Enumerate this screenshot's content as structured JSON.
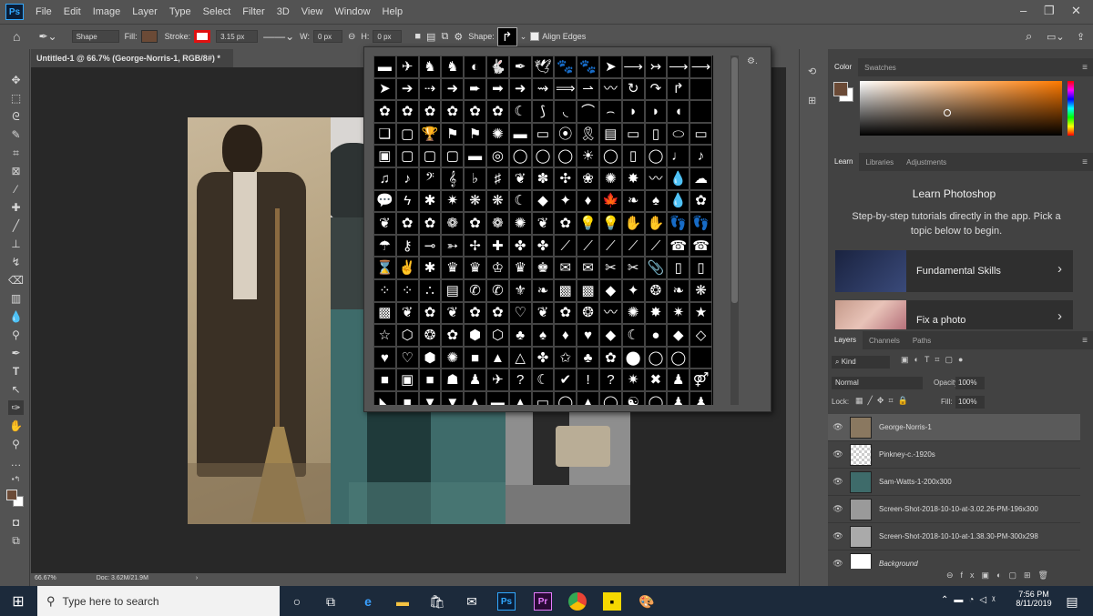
{
  "menubar": {
    "logo": "Ps",
    "items": [
      "File",
      "Edit",
      "Image",
      "Layer",
      "Type",
      "Select",
      "Filter",
      "3D",
      "View",
      "Window",
      "Help"
    ]
  },
  "options": {
    "mode": "Shape",
    "fill_label": "Fill:",
    "stroke_label": "Stroke:",
    "stroke_width": "3.15 px",
    "w_label": "W:",
    "w_value": "0 px",
    "h_label": "H:",
    "h_value": "0 px",
    "shape_label": "Shape:",
    "align_edges": "Align Edges"
  },
  "document": {
    "tab_title": "Untitled-1 @ 66.7% (George-Norris-1, RGB/8#) *",
    "zoom": "66.67%",
    "doc_info": "Doc: 3.62M/21.9M"
  },
  "shape_picker": {
    "shapes": [
      "▬",
      "✈",
      "♞",
      "♞",
      "◐",
      "🐇",
      "✒",
      "🕊",
      "🐾",
      "🐾",
      "➤",
      "⟶",
      "↣",
      "⟶",
      "⟶",
      "➤",
      "➔",
      "⇢",
      "➜",
      "➨",
      "➡",
      "➜",
      "⇝",
      "⟹",
      "⇀",
      "〰",
      "↻",
      "↷",
      "↱",
      "",
      "✿",
      "✿",
      "✿",
      "✿",
      "✿",
      "✿",
      "☾",
      "⟆",
      "◟",
      "⌒",
      "⌢",
      "◗",
      "◗",
      "◖",
      "",
      "❑",
      "▢",
      "🏆",
      "⚑",
      "⚑",
      "✺",
      "▬",
      "▭",
      "⦿",
      "🎗",
      "▤",
      "▭",
      "▯",
      "⬭",
      "▭",
      "▣",
      "▢",
      "▢",
      "▢",
      "▬",
      "◎",
      "◯",
      "◯",
      "◯",
      "☀",
      "◯",
      "▯",
      "◯",
      "♩",
      "♪",
      "♫",
      "♪",
      "𝄢",
      "𝄞",
      "♭",
      "♯",
      "❦",
      "✽",
      "✣",
      "❀",
      "✺",
      "✸",
      "〰",
      "💧",
      "☁",
      "💬",
      "ϟ",
      "✱",
      "✷",
      "❋",
      "❋",
      "☾",
      "◆",
      "✦",
      "♦",
      "🍁",
      "❧",
      "♠",
      "💧",
      "✿",
      "❦",
      "✿",
      "✿",
      "❁",
      "✿",
      "❁",
      "✺",
      "❦",
      "✿",
      "💡",
      "💡",
      "✋",
      "✋",
      "👣",
      "👣",
      "☂",
      "⚷",
      "⊸",
      "➳",
      "✢",
      "✚",
      "✤",
      "✤",
      "⟋",
      "⟋",
      "⟋",
      "⟋",
      "⟋",
      "☎",
      "☎",
      "⌛",
      "✌",
      "✱",
      "♛",
      "♛",
      "♔",
      "♛",
      "♚",
      "✉",
      "✉",
      "✂",
      "✂",
      "📎",
      "▯",
      "▯",
      "⁘",
      "⁘",
      "∴",
      "▤",
      "✆",
      "✆",
      "⚜",
      "❧",
      "▩",
      "▩",
      "◆",
      "✦",
      "❂",
      "❧",
      "❋",
      "▩",
      "❦",
      "✿",
      "❦",
      "✿",
      "✿",
      "♡",
      "❦",
      "✿",
      "❂",
      "〰",
      "✺",
      "✸",
      "✷",
      "★",
      "☆",
      "⬡",
      "❂",
      "✿",
      "⬢",
      "⬡",
      "♣",
      "♠",
      "♦",
      "♥",
      "◆",
      "☾",
      "●",
      "◆",
      "◇",
      "♥",
      "♡",
      "⬢",
      "✺",
      "■",
      "▲",
      "△",
      "✤",
      "✩",
      "♣",
      "✿",
      "⬤",
      "◯",
      "◯",
      "",
      "■",
      "▣",
      "■",
      "☗",
      "♟",
      "✈",
      "?",
      "☾",
      "✔",
      "!",
      "?",
      "✷",
      "✖",
      "♟",
      "⚤",
      "◣",
      "■",
      "▼",
      "▼",
      "▲",
      "▬",
      "▲",
      "▭",
      "◯",
      "▲",
      "◯",
      "☯",
      "◯",
      "♟",
      "♟"
    ]
  },
  "color_panel": {
    "tabs": [
      "Color",
      "Swatches"
    ],
    "fg_color": "#6b4a36",
    "bg_color": "#ffffff"
  },
  "learn_panel": {
    "tabs": [
      "Learn",
      "Libraries",
      "Adjustments"
    ],
    "title": "Learn Photoshop",
    "subtitle": "Step-by-step tutorials directly in the app. Pick a topic below to begin.",
    "cards": [
      "Fundamental Skills",
      "Fix a photo"
    ]
  },
  "layers_panel": {
    "tabs": [
      "Layers",
      "Channels",
      "Paths"
    ],
    "kind": "Kind",
    "blend_mode": "Normal",
    "opacity_label": "Opacity:",
    "opacity": "100%",
    "lock_label": "Lock:",
    "fill_label": "Fill:",
    "fill": "100%",
    "layers": [
      {
        "name": "George-Norris-1",
        "selected": true
      },
      {
        "name": "Pinkney-c.-1920s",
        "selected": false
      },
      {
        "name": "Sam-Watts-1-200x300",
        "selected": false
      },
      {
        "name": "Screen-Shot-2018-10-10-at-3.02.26-PM-196x300",
        "selected": false
      },
      {
        "name": "Screen-Shot-2018-10-10-at-1.38.30-PM-300x298",
        "selected": false
      },
      {
        "name": "Background",
        "selected": false
      }
    ]
  },
  "taskbar": {
    "search_placeholder": "Type here to search",
    "time": "7:56 PM",
    "date": "8/11/2019"
  }
}
